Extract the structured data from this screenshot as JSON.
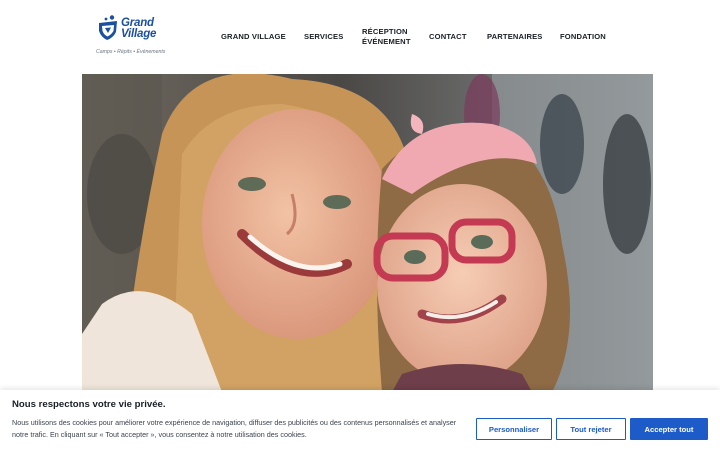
{
  "header": {
    "logo": {
      "name_line1": "Grand",
      "name_line2": "Village",
      "tagline": "Camps • Répits • Événements",
      "brand_color": "#1b4fa0"
    },
    "nav": [
      {
        "label": "GRAND VILLAGE"
      },
      {
        "label": "SERVICES"
      },
      {
        "label_line1": "RÉCEPTION",
        "label_line2": "ÉVÉNEMENT"
      },
      {
        "label": "CONTACT"
      },
      {
        "label": "PARTENAIRES"
      },
      {
        "label": "FONDATION"
      }
    ]
  },
  "hero": {
    "image": "photo-two-smiling-girls"
  },
  "cookie_banner": {
    "title": "Nous respectons votre vie privée.",
    "text": "Nous utilisons des cookies pour améliorer votre expérience de navigation, diffuser des publicités ou des contenus personnalisés et analyser notre trafic. En cliquant sur « Tout accepter », vous consentez à notre utilisation des cookies.",
    "buttons": {
      "customize": "Personnaliser",
      "reject": "Tout rejeter",
      "accept": "Accepter tout"
    },
    "accent_color": "#1d5bc8"
  }
}
